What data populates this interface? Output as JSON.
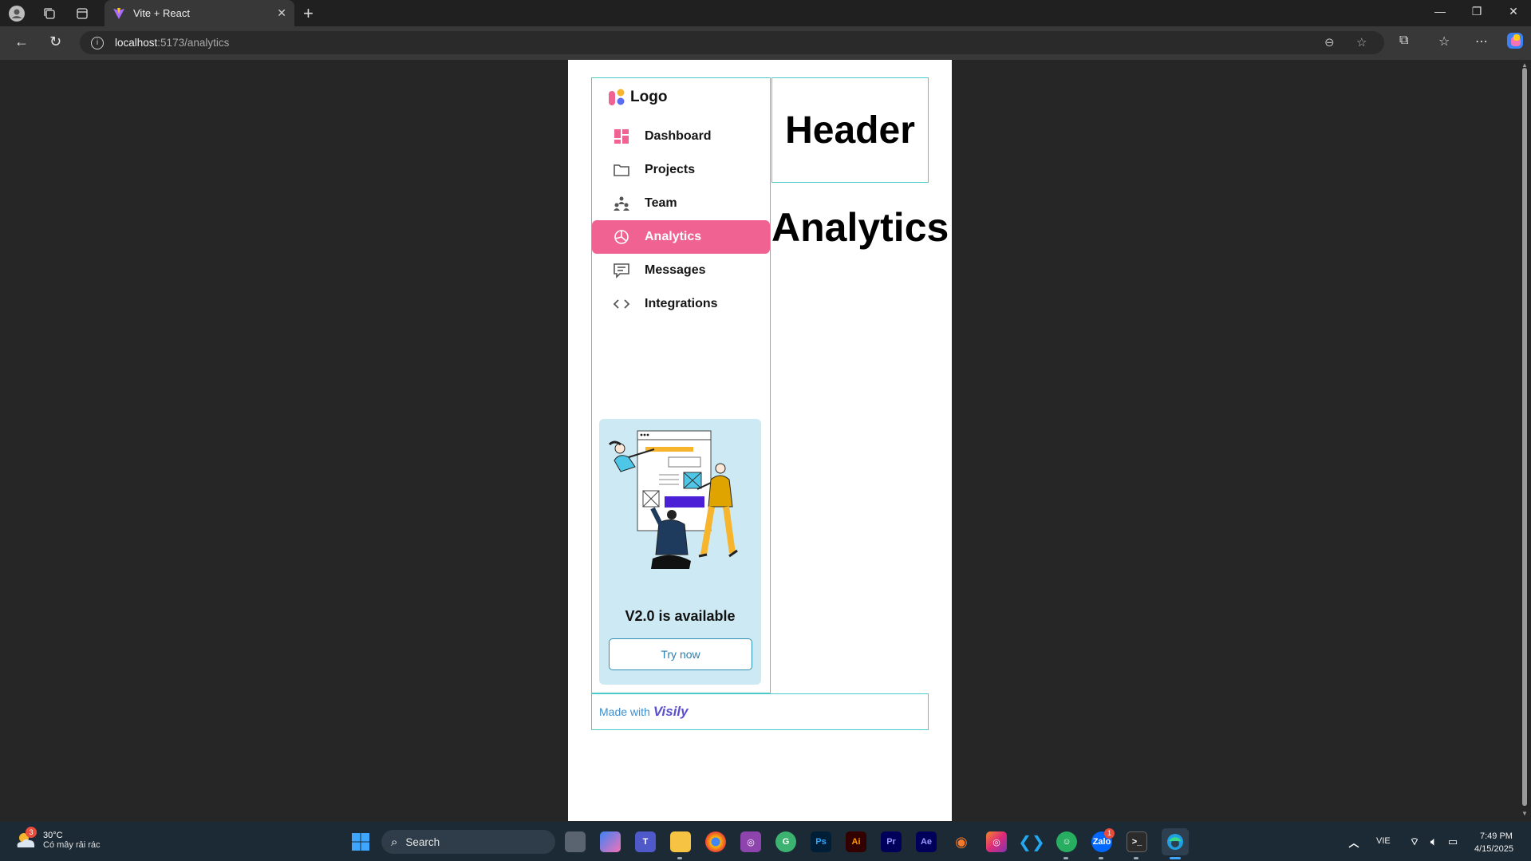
{
  "browser": {
    "tab_title": "Vite + React",
    "url_host": "localhost",
    "url_path": ":5173/analytics"
  },
  "app": {
    "logo_label": "Logo",
    "menu": [
      {
        "label": "Dashboard",
        "icon": "dashboard-icon",
        "active": false
      },
      {
        "label": "Projects",
        "icon": "folder-icon",
        "active": false
      },
      {
        "label": "Team",
        "icon": "team-icon",
        "active": false
      },
      {
        "label": "Analytics",
        "icon": "pie-chart-icon",
        "active": true
      },
      {
        "label": "Messages",
        "icon": "message-icon",
        "active": false
      },
      {
        "label": "Integrations",
        "icon": "code-icon",
        "active": false
      }
    ],
    "promo": {
      "title": "V2.0 is available",
      "button": "Try now"
    },
    "header_label": "Header",
    "page_title": "Analytics",
    "footer": {
      "made_with": "Made with",
      "brand": "Visily"
    },
    "accent_color": "#f06292",
    "border_color": "#4cc9c9"
  },
  "taskbar": {
    "weather_temp": "30°C",
    "weather_desc": "Có mây rải rác",
    "weather_badge": "3",
    "search_label": "Search",
    "language": "VIE",
    "time": "7:49 PM",
    "date": "4/15/2025",
    "zalo_badge": "1"
  }
}
